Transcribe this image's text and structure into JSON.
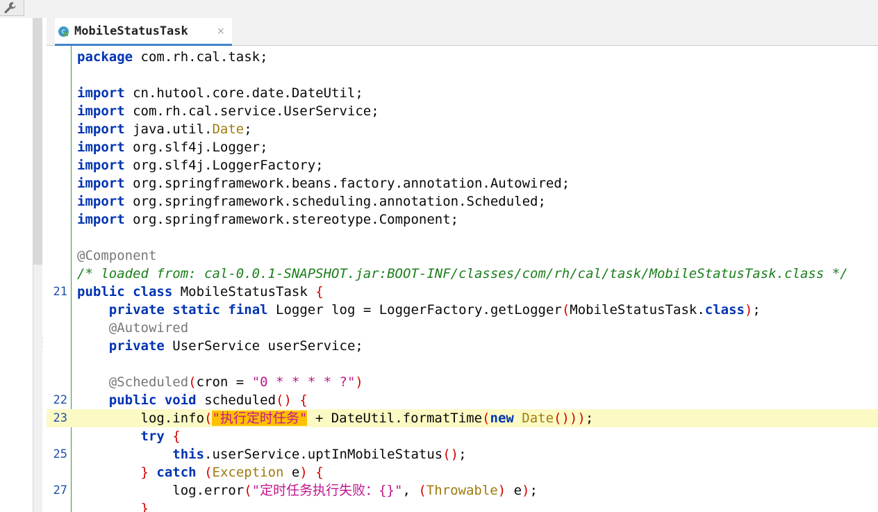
{
  "tab": {
    "icon_letter": "c",
    "title": "MobileStatusTask",
    "close_glyph": "×"
  },
  "lines": [
    {
      "ln": "",
      "tokens": [
        [
          "kw",
          "package"
        ],
        [
          "p",
          " com.rh.cal.task;"
        ]
      ]
    },
    {
      "ln": "",
      "tokens": []
    },
    {
      "ln": "",
      "tokens": [
        [
          "kw",
          "import"
        ],
        [
          "p",
          " cn.hutool.core.date.DateUtil;"
        ]
      ]
    },
    {
      "ln": "",
      "tokens": [
        [
          "kw",
          "import"
        ],
        [
          "p",
          " com.rh.cal.service.UserService;"
        ]
      ]
    },
    {
      "ln": "",
      "tokens": [
        [
          "kw",
          "import"
        ],
        [
          "p",
          " java.util."
        ],
        [
          "cls",
          "Date"
        ],
        [
          "p",
          ";"
        ]
      ]
    },
    {
      "ln": "",
      "tokens": [
        [
          "kw",
          "import"
        ],
        [
          "p",
          " org.slf4j.Logger;"
        ]
      ]
    },
    {
      "ln": "",
      "tokens": [
        [
          "kw",
          "import"
        ],
        [
          "p",
          " org.slf4j.LoggerFactory;"
        ]
      ]
    },
    {
      "ln": "",
      "tokens": [
        [
          "kw",
          "import"
        ],
        [
          "p",
          " org.springframework.beans.factory.annotation.Autowired;"
        ]
      ]
    },
    {
      "ln": "",
      "tokens": [
        [
          "kw",
          "import"
        ],
        [
          "p",
          " org.springframework.scheduling.annotation.Scheduled;"
        ]
      ]
    },
    {
      "ln": "",
      "tokens": [
        [
          "kw",
          "import"
        ],
        [
          "p",
          " org.springframework.stereotype.Component;"
        ]
      ]
    },
    {
      "ln": "",
      "tokens": []
    },
    {
      "ln": "",
      "tokens": [
        [
          "ann",
          "@Component"
        ]
      ]
    },
    {
      "ln": "",
      "tokens": [
        [
          "cmt",
          "/* loaded from: cal-0.0.1-SNAPSHOT.jar:BOOT-INF/classes/com/rh/cal/task/MobileStatusTask.class */"
        ]
      ]
    },
    {
      "ln": "21",
      "tokens": [
        [
          "kw",
          "public"
        ],
        [
          "p",
          " "
        ],
        [
          "kw",
          "class"
        ],
        [
          "p",
          " MobileStatusTask "
        ],
        [
          "br",
          "{"
        ]
      ]
    },
    {
      "ln": "",
      "tokens": [
        [
          "p",
          "    "
        ],
        [
          "kw",
          "private"
        ],
        [
          "p",
          " "
        ],
        [
          "kw",
          "static"
        ],
        [
          "p",
          " "
        ],
        [
          "kw",
          "final"
        ],
        [
          "p",
          " Logger log = LoggerFactory.getLogger"
        ],
        [
          "br",
          "("
        ],
        [
          "p",
          "MobileStatusTask."
        ],
        [
          "kw",
          "class"
        ],
        [
          "br",
          ")"
        ],
        [
          "p",
          ";"
        ]
      ]
    },
    {
      "ln": "",
      "tokens": [
        [
          "p",
          "    "
        ],
        [
          "ann",
          "@Autowired"
        ]
      ]
    },
    {
      "ln": "",
      "tokens": [
        [
          "p",
          "    "
        ],
        [
          "kw",
          "private"
        ],
        [
          "p",
          " UserService userService;"
        ]
      ]
    },
    {
      "ln": "",
      "tokens": []
    },
    {
      "ln": "",
      "tokens": [
        [
          "p",
          "    "
        ],
        [
          "ann",
          "@Scheduled"
        ],
        [
          "br",
          "("
        ],
        [
          "p",
          "cron = "
        ],
        [
          "str",
          "\"0 * * * * ?\""
        ],
        [
          "br",
          ")"
        ]
      ]
    },
    {
      "ln": "22",
      "tokens": [
        [
          "p",
          "    "
        ],
        [
          "kw",
          "public"
        ],
        [
          "p",
          " "
        ],
        [
          "kw",
          "void"
        ],
        [
          "p",
          " scheduled"
        ],
        [
          "br",
          "()"
        ],
        [
          "p",
          " "
        ],
        [
          "br",
          "{"
        ]
      ]
    },
    {
      "ln": "23",
      "current": true,
      "tokens": [
        [
          "p",
          "        log.info"
        ],
        [
          "br",
          "("
        ],
        [
          "strhl",
          "\"执行定时任务\""
        ],
        [
          "p",
          " + DateUtil.formatTime"
        ],
        [
          "br",
          "("
        ],
        [
          "kw",
          "new"
        ],
        [
          "p",
          " "
        ],
        [
          "cls",
          "Date"
        ],
        [
          "br",
          "()))"
        ],
        [
          "p",
          ";"
        ]
      ]
    },
    {
      "ln": "",
      "tokens": [
        [
          "p",
          "        "
        ],
        [
          "kw",
          "try"
        ],
        [
          "p",
          " "
        ],
        [
          "br",
          "{"
        ]
      ]
    },
    {
      "ln": "25",
      "tokens": [
        [
          "p",
          "            "
        ],
        [
          "kw",
          "this"
        ],
        [
          "p",
          ".userService.uptInMobileStatus"
        ],
        [
          "br",
          "()"
        ],
        [
          "p",
          ";"
        ]
      ]
    },
    {
      "ln": "",
      "tokens": [
        [
          "p",
          "        "
        ],
        [
          "br",
          "}"
        ],
        [
          "p",
          " "
        ],
        [
          "kw",
          "catch"
        ],
        [
          "p",
          " "
        ],
        [
          "br",
          "("
        ],
        [
          "cls",
          "Exception"
        ],
        [
          "p",
          " e"
        ],
        [
          "br",
          ")"
        ],
        [
          "p",
          " "
        ],
        [
          "br",
          "{"
        ]
      ]
    },
    {
      "ln": "27",
      "tokens": [
        [
          "p",
          "            log.error"
        ],
        [
          "br",
          "("
        ],
        [
          "str",
          "\"定时任务执行失败：{}\""
        ],
        [
          "p",
          ", "
        ],
        [
          "br",
          "("
        ],
        [
          "cls",
          "Throwable"
        ],
        [
          "br",
          ")"
        ],
        [
          "p",
          " e"
        ],
        [
          "br",
          ")"
        ],
        [
          "p",
          ";"
        ]
      ]
    },
    {
      "ln": "",
      "tokens": [
        [
          "p",
          "        "
        ],
        [
          "br",
          "}"
        ]
      ]
    }
  ]
}
